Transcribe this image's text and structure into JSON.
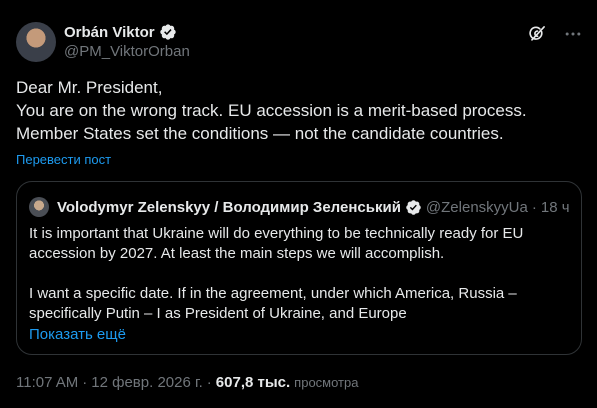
{
  "author": {
    "display_name": "Orbán Viktor",
    "handle": "@PM_ViktorOrban"
  },
  "icons": {
    "verified": "verified-badge-icon",
    "grok": "grok-icon",
    "more": "more-options-icon"
  },
  "post": {
    "lines": [
      "Dear Mr. President,",
      "You are on the wrong track. EU accession is a merit-based process.",
      "Member States set the conditions — not the candidate countries."
    ],
    "translate_label": "Перевести пост"
  },
  "quote": {
    "display_name": "Volodymyr Zelenskyy / Володимир Зеленський",
    "handle": "@ZelenskyyUa",
    "separator": "·",
    "time": "18 ч",
    "paragraph1": "It is important that Ukraine will do everything to be technically ready for EU accession by 2027. At least the main steps we will accomplish.",
    "paragraph2": "I want a specific date. If in the agreement, under which America, Russia – specifically Putin – I as President of Ukraine, and Europe",
    "show_more": "Показать ещё"
  },
  "meta": {
    "time": "11:07 AM",
    "separator": "·",
    "date": "12 февр. 2026 г.",
    "views_count": "607,8 тыс.",
    "views_label": "просмотра"
  },
  "colors": {
    "background": "#000000",
    "text": "#e7e9ea",
    "muted": "#71767b",
    "link": "#1d9bf0",
    "border": "#2f3336",
    "verified": "#1d9bf0"
  }
}
